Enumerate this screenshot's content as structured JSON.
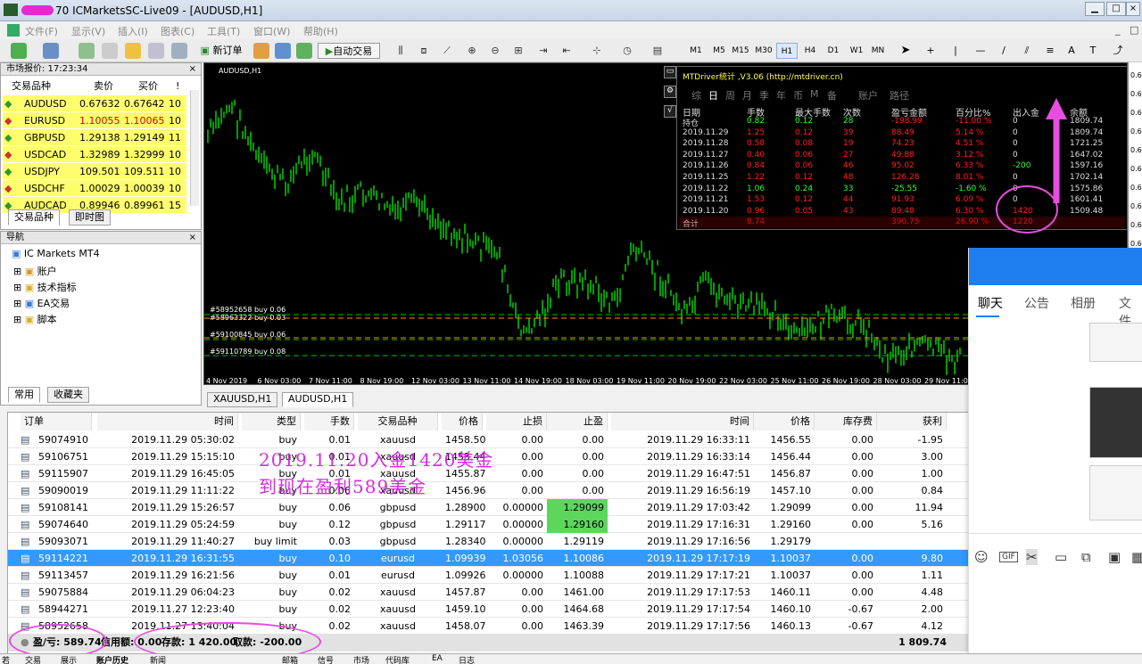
{
  "window": {
    "title": "70 ICMarketsSC-Live09 - [AUDUSD,H1]"
  },
  "menu": [
    "文件(F)",
    "显示(V)",
    "插入(I)",
    "图表(C)",
    "工具(T)",
    "窗口(W)",
    "帮助(H)"
  ],
  "toolbar": {
    "new_order": "新订单",
    "auto_trade": "自动交易",
    "timeframes": [
      "M1",
      "M5",
      "M15",
      "M30",
      "H1",
      "H4",
      "D1",
      "W1",
      "MN"
    ],
    "active_tf": "H1"
  },
  "market_watch": {
    "title": "市场报价: 17:23:34",
    "headers": [
      "交易品种",
      "卖价",
      "买价",
      "!"
    ],
    "rows": [
      {
        "symbol": "AUDUSD",
        "bid": "0.67632",
        "ask": "0.67642",
        "spread": "10"
      },
      {
        "symbol": "EURUSD",
        "bid": "1.10055",
        "ask": "1.10065",
        "spread": "10"
      },
      {
        "symbol": "GBPUSD",
        "bid": "1.29138",
        "ask": "1.29149",
        "spread": "11"
      },
      {
        "symbol": "USDCAD",
        "bid": "1.32989",
        "ask": "1.32999",
        "spread": "10"
      },
      {
        "symbol": "USDJPY",
        "bid": "109.501",
        "ask": "109.511",
        "spread": "10"
      },
      {
        "symbol": "USDCHF",
        "bid": "1.00029",
        "ask": "1.00039",
        "spread": "10"
      },
      {
        "symbol": "AUDCAD",
        "bid": "0.89946",
        "ask": "0.89961",
        "spread": "15"
      }
    ],
    "tabs": [
      "交易品种",
      "即时图"
    ]
  },
  "navigator": {
    "title": "导航",
    "root": "IC Markets MT4",
    "items": [
      "账户",
      "技术指标",
      "EA交易",
      "脚本"
    ],
    "tabs": [
      "常用",
      "收藏夹"
    ]
  },
  "chart": {
    "symbol_label": "AUDUSD,H1",
    "x_labels": [
      "4 Nov 2019",
      "6 Nov 03:00",
      "7 Nov 11:00",
      "8 Nov 19:00",
      "12 Nov 03:00",
      "13 Nov 11:00",
      "14 Nov 19:00",
      "18 Nov 03:00",
      "19 Nov 11:00",
      "20 Nov 19:00",
      "22 Nov 03:00",
      "25 Nov 11:00",
      "26 Nov 19:00",
      "28 Nov 03:00",
      "29 Nov 11:00"
    ],
    "y_labels": [
      "0.6",
      "0.6",
      "0.6",
      "0.6",
      "0.6",
      "0.6",
      "0.6",
      "0.6",
      "0.6",
      "0.6",
      "0.6",
      "0.6",
      "0.6",
      "0.6",
      "0.6",
      "0.6",
      "0.6"
    ],
    "order_lines": [
      "#58952658 buy 0.06",
      "#58963322 buy 0.03",
      "#59100845 buy 0.06",
      "#59110789 buy 0.08"
    ],
    "tabs": [
      "XAUUSD,H1",
      "AUDUSD,H1"
    ],
    "active_tab": "AUDUSD,H1"
  },
  "stats": {
    "title": "MTDriver统计 ,V3.06 (http://mtdriver.cn)",
    "nav": [
      "综",
      "日",
      "周",
      "月",
      "季",
      "年",
      "币",
      "M",
      "备",
      "账户",
      "路径"
    ],
    "nav_active": "日",
    "headers": [
      "日期",
      "手数",
      "最大手数",
      "次数",
      "盈亏金额",
      "百分比%",
      "出入金",
      "余额"
    ],
    "rows": [
      [
        "持仓",
        "0.82",
        "0.12",
        "28",
        "-198.99",
        "-11.00 %",
        "0",
        "1809.74"
      ],
      [
        "2019.11.29",
        "1.25",
        "0.12",
        "39",
        "88.49",
        "5.14 %",
        "0",
        "1809.74"
      ],
      [
        "2019.11.28",
        "0.58",
        "0.08",
        "19",
        "74.23",
        "4.51 %",
        "0",
        "1721.25"
      ],
      [
        "2019.11.27",
        "0.40",
        "0.06",
        "27",
        "49.88",
        "3.12 %",
        "0",
        "1647.02"
      ],
      [
        "2019.11.26",
        "0.84",
        "0.06",
        "46",
        "95.02",
        "6.33 %",
        "-200",
        "1597.16"
      ],
      [
        "2019.11.25",
        "1.22",
        "0.12",
        "48",
        "126.28",
        "8.01 %",
        "0",
        "1702.14"
      ],
      [
        "2019.11.22",
        "1.06",
        "0.24",
        "33",
        "-25.55",
        "-1.60 %",
        "0",
        "1575.86"
      ],
      [
        "2019.11.21",
        "1.53",
        "0.12",
        "44",
        "91.93",
        "6.09 %",
        "0",
        "1601.41"
      ],
      [
        "2019.11.20",
        "0.96",
        "0.05",
        "43",
        "89.48",
        "6.30 %",
        "1420",
        "1509.48"
      ],
      [
        "合计",
        "8.74",
        "",
        "",
        "390.75",
        "26.90 %",
        "1220",
        ""
      ]
    ]
  },
  "terminal": {
    "headers": [
      "订单",
      "时间",
      "类型",
      "手数",
      "交易品种",
      "价格",
      "止损",
      "止盈",
      "时间",
      "价格",
      "库存费",
      "获利"
    ],
    "rows": [
      [
        "59074910",
        "2019.11.29 05:30:02",
        "buy",
        "0.01",
        "xauusd",
        "1458.50",
        "0.00",
        "0.00",
        "2019.11.29 16:33:11",
        "1456.55",
        "0.00",
        "-1.95"
      ],
      [
        "59106751",
        "2019.11.29 15:15:10",
        "buy",
        "0.01",
        "xauusd",
        "1453.44",
        "0.00",
        "0.00",
        "2019.11.29 16:33:14",
        "1456.44",
        "0.00",
        "3.00"
      ],
      [
        "59115907",
        "2019.11.29 16:45:05",
        "buy",
        "0.01",
        "xauusd",
        "1455.87",
        "0.00",
        "0.00",
        "2019.11.29 16:47:51",
        "1456.87",
        "0.00",
        "1.00"
      ],
      [
        "59090019",
        "2019.11.29 11:11:22",
        "buy",
        "0.06",
        "xauusd",
        "1456.96",
        "0.00",
        "0.00",
        "2019.11.29 16:56:19",
        "1457.10",
        "0.00",
        "0.84"
      ],
      [
        "59108141",
        "2019.11.29 15:26:57",
        "buy",
        "0.06",
        "gbpusd",
        "1.28900",
        "0.00000",
        "1.29099",
        "2019.11.29 17:03:42",
        "1.29099",
        "0.00",
        "11.94"
      ],
      [
        "59074640",
        "2019.11.29 05:24:59",
        "buy",
        "0.12",
        "gbpusd",
        "1.29117",
        "0.00000",
        "1.29160",
        "2019.11.29 17:16:31",
        "1.29160",
        "0.00",
        "5.16"
      ],
      [
        "59093071",
        "2019.11.29 11:40:27",
        "buy limit",
        "0.03",
        "gbpusd",
        "1.28340",
        "0.00000",
        "1.29119",
        "2019.11.29 17:16:56",
        "1.29179",
        "",
        ""
      ],
      [
        "59114221",
        "2019.11.29 16:31:55",
        "buy",
        "0.10",
        "eurusd",
        "1.09939",
        "1.03056",
        "1.10086",
        "2019.11.29 17:17:19",
        "1.10037",
        "0.00",
        "9.80"
      ],
      [
        "59113457",
        "2019.11.29 16:21:56",
        "buy",
        "0.01",
        "eurusd",
        "1.09926",
        "0.00000",
        "1.10088",
        "2019.11.29 17:17:21",
        "1.10037",
        "0.00",
        "1.11"
      ],
      [
        "59075884",
        "2019.11.29 06:04:23",
        "buy",
        "0.02",
        "xauusd",
        "1457.87",
        "0.00",
        "1461.00",
        "2019.11.29 17:17:53",
        "1460.11",
        "0.00",
        "4.48"
      ],
      [
        "58944271",
        "2019.11.27 12:23:40",
        "buy",
        "0.02",
        "xauusd",
        "1459.10",
        "0.00",
        "1464.68",
        "2019.11.29 17:17:54",
        "1460.10",
        "-0.67",
        "2.00"
      ],
      [
        "58952658",
        "2019.11.27 13:40:04",
        "buy",
        "0.02",
        "xauusd",
        "1458.07",
        "0.00",
        "1463.39",
        "2019.11.29 17:17:56",
        "1460.13",
        "-0.67",
        "4.12"
      ]
    ],
    "selected_row": 7,
    "highlight_tp_rows": [
      4,
      5
    ],
    "total": {
      "pl": "盈/亏: 589.74",
      "credit": "信用额: 0.00",
      "deposit": "存款: 1 420.00",
      "withdraw": "取款: -200.00",
      "sum": "1 809.74"
    },
    "bottom_tabs": [
      "交易",
      "展示",
      "账户历史",
      "新闻",
      "",
      "",
      "",
      "",
      "邮箱",
      "信号",
      "市场",
      "代码库",
      "EA",
      "日志"
    ]
  },
  "annotation": {
    "line1": "2019.11.20入金1420美金",
    "line2": "到现在盈利589美金"
  },
  "chat": {
    "tabs": [
      "聊天",
      "公告",
      "相册",
      "文件"
    ],
    "active": "聊天"
  },
  "colors": {
    "chart_bg": "#000000",
    "candles": "#00e000",
    "order_line_green": "#00c000",
    "order_line_orange": "#ff8c00",
    "selected_row": "#3399ff",
    "tp_highlight": "#5cd65c",
    "market_row": "#ffff6e",
    "annotation": "#d22edc",
    "stat_red": "#ff2020",
    "stat_green": "#30ff30"
  },
  "status": {
    "left": "若"
  }
}
